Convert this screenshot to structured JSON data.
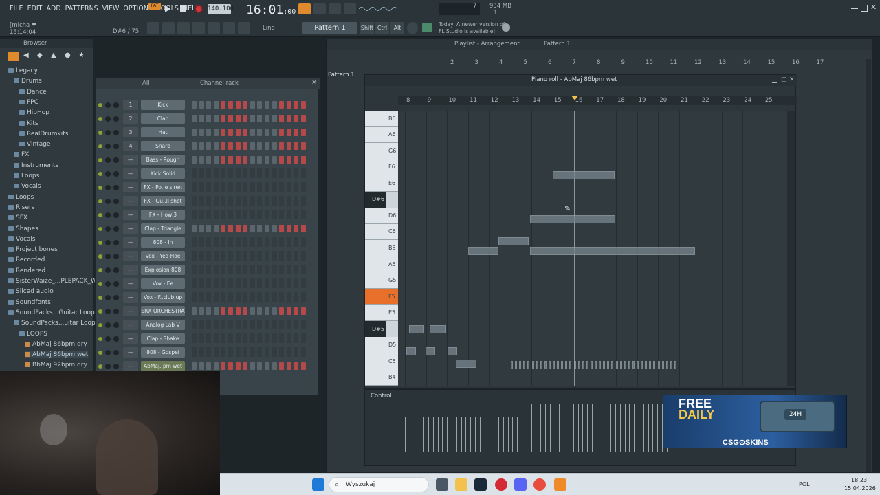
{
  "menu": [
    "FILE",
    "EDIT",
    "ADD",
    "PATTERNS",
    "VIEW",
    "OPTIONS",
    "TOOLS",
    "HELP"
  ],
  "transport": {
    "pat_label": "PAT",
    "tempo": "140.100",
    "clock_main": "16:01",
    "clock_sub": "00",
    "cpu_value": "7",
    "mem": "934 MB",
    "mem_sub": "1",
    "snap": "Line",
    "pattern_select": "Pattern 1"
  },
  "status": {
    "user": "[micha ❤",
    "time": "15:14:04",
    "note": "D#6 / 75"
  },
  "notice": {
    "line1": "Today: A newer version of",
    "line2": "FL Studio is available!"
  },
  "browser": {
    "title": "Browser",
    "items": [
      {
        "label": "Legacy"
      },
      {
        "label": "Drums"
      },
      {
        "label": "Dance"
      },
      {
        "label": "FPC"
      },
      {
        "label": "HipHop"
      },
      {
        "label": "Kits"
      },
      {
        "label": "RealDrumkits"
      },
      {
        "label": "Vintage"
      },
      {
        "label": "FX"
      },
      {
        "label": "Instruments"
      },
      {
        "label": "Loops"
      },
      {
        "label": "Vocals"
      },
      {
        "label": "Loops"
      },
      {
        "label": "Risers"
      },
      {
        "label": "SFX"
      },
      {
        "label": "Shapes"
      },
      {
        "label": "Vocals"
      },
      {
        "label": "Project bones"
      },
      {
        "label": "Recorded"
      },
      {
        "label": "Rendered"
      },
      {
        "label": "SisterWaize_...PLEPACK_WAV"
      },
      {
        "label": "Sliced audio"
      },
      {
        "label": "Soundfonts"
      },
      {
        "label": "SoundPacks...Guitar Loops"
      },
      {
        "label": "SoundPacks...uitar Loops"
      },
      {
        "label": "LOOPS"
      },
      {
        "label": "AbMaj 86bpm dry"
      },
      {
        "label": "AbMaj 86bpm wet"
      },
      {
        "label": "BbMaj 92bpm dry"
      }
    ]
  },
  "rack": {
    "title": "Channel rack",
    "filter": "All",
    "channels": [
      {
        "num": "1",
        "name": "Kick"
      },
      {
        "num": "2",
        "name": "Clap"
      },
      {
        "num": "3",
        "name": "Hat"
      },
      {
        "num": "4",
        "name": "Snare"
      },
      {
        "num": "—",
        "name": "Bass - Rough"
      },
      {
        "num": "—",
        "name": "Kick Solid"
      },
      {
        "num": "—",
        "name": "FX - Po..e siren"
      },
      {
        "num": "—",
        "name": "FX - Gu..ll shot"
      },
      {
        "num": "—",
        "name": "FX - Howl3"
      },
      {
        "num": "—",
        "name": "Clap - Triangle"
      },
      {
        "num": "—",
        "name": "808 - In"
      },
      {
        "num": "—",
        "name": "Vox - Yea Hoe"
      },
      {
        "num": "—",
        "name": "Explosion 808"
      },
      {
        "num": "—",
        "name": "Vox - Ee"
      },
      {
        "num": "—",
        "name": "Vox - F..club up"
      },
      {
        "num": "—",
        "name": "SRX ORCHESTRA"
      },
      {
        "num": "—",
        "name": "Analog Lab V"
      },
      {
        "num": "—",
        "name": "Clap - Shake"
      },
      {
        "num": "—",
        "name": "808 - Gospel"
      },
      {
        "num": "—",
        "name": "AbMaj..pm wet"
      }
    ]
  },
  "playlist": {
    "title": "Playlist - Arrangement",
    "pattern": "Pattern 1",
    "pattern_item": "Pattern 1",
    "bars": [
      "2",
      "3",
      "4",
      "5",
      "6",
      "7",
      "8",
      "9",
      "10",
      "11",
      "12",
      "13",
      "14",
      "15",
      "16",
      "17"
    ]
  },
  "pianoroll": {
    "title": "Piano roll - AbMaj 86bpm wet",
    "ruler": [
      "8",
      "9",
      "10",
      "11",
      "12",
      "13",
      "14",
      "15",
      "16",
      "17",
      "18",
      "19",
      "20",
      "21",
      "22",
      "23",
      "24",
      "25"
    ],
    "keys": [
      "B6",
      "A6",
      "G6",
      "F6",
      "E6",
      "D#6",
      "D6",
      "C6",
      "B5",
      "A5",
      "G5",
      "F5",
      "E5",
      "D#5",
      "D5",
      "C5",
      "B4"
    ],
    "control_label": "Control"
  },
  "ad": {
    "line1": "FREE",
    "line2": "DAILY",
    "brand": "CSG⊙SKINS",
    "badge": "24H"
  },
  "taskbar": {
    "search": "Wyszukaj",
    "lang": "POL",
    "time": "18:23",
    "date": "15.04.2026"
  },
  "colors": {
    "accent": "#e8702a",
    "green": "#8aa531",
    "step_red": "#b5494a",
    "step_grey": "#5b666c"
  }
}
